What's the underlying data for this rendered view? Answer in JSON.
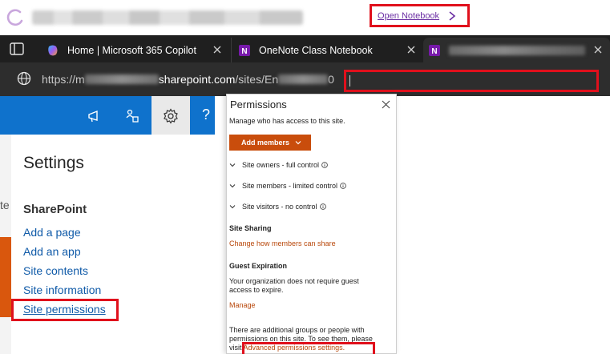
{
  "top": {
    "open_notebook_label": "Open Notebook"
  },
  "browser": {
    "tabs": [
      {
        "label": "Home | Microsoft 365 Copilot"
      },
      {
        "label": "OneNote Class Notebook"
      }
    ],
    "url": {
      "scheme": "https://",
      "prefix": "m",
      "domain": "sharepoint.com",
      "path": "/sites/En",
      "trailing": "0",
      "cursor": "/"
    }
  },
  "sidebar": {
    "cut_text": "te",
    "title": "Settings",
    "heading": "SharePoint",
    "links": [
      {
        "label": "Add a page"
      },
      {
        "label": "Add an app"
      },
      {
        "label": "Site contents"
      },
      {
        "label": "Site information"
      },
      {
        "label": "Site permissions"
      }
    ],
    "help_glyph": "?"
  },
  "panel": {
    "title": "Permissions",
    "subtitle": "Manage who has access to this site.",
    "add_members_label": "Add members",
    "groups": [
      {
        "label": "Site owners - full control"
      },
      {
        "label": "Site members - limited control"
      },
      {
        "label": "Site visitors - no control"
      }
    ],
    "sharing": {
      "heading": "Site Sharing",
      "link": "Change how members can share"
    },
    "guest": {
      "heading": "Guest Expiration",
      "text": "Your organization does not require guest access to expire.",
      "link": "Manage"
    },
    "additional": {
      "text": "There are additional groups or people with permissions on this site. To see them, please visit",
      "link": "Advanced permissions settings."
    }
  },
  "colors": {
    "suite_blue": "#0f72cc",
    "accent_orange": "#c94d0c",
    "highlight_red": "#e0101c",
    "link_blue": "#0f5aa8"
  }
}
